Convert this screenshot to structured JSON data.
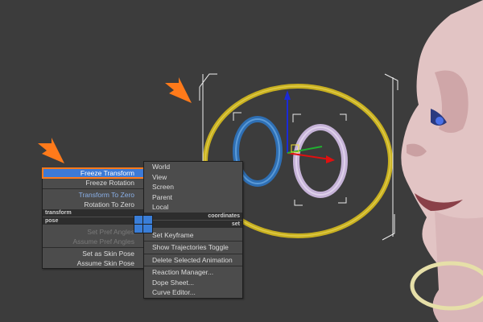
{
  "viewport": {
    "background": "#3c3c3c",
    "objects": [
      "gold-ring",
      "blue-ring",
      "lilac-ring",
      "cream-ring",
      "character-head",
      "transform-gizmo"
    ]
  },
  "quad_menu": {
    "transform_section": {
      "title": "transform",
      "items": [
        {
          "label": "Freeze Transform",
          "state": "highlighted"
        },
        {
          "label": "Freeze Rotation",
          "state": "normal"
        },
        {
          "label": "Transform To Zero",
          "state": "normal"
        },
        {
          "label": "Rotation To Zero",
          "state": "normal"
        }
      ]
    },
    "coordinates_section": {
      "title": "coordinates",
      "items": [
        "World",
        "View",
        "Screen",
        "Parent",
        "Local"
      ]
    },
    "pose_section": {
      "title": "pose",
      "items": [
        {
          "label": "Set Pref Angles",
          "state": "disabled"
        },
        {
          "label": "Assume Pref Angles",
          "state": "disabled"
        },
        {
          "label": "Set as Skin Pose",
          "state": "normal"
        },
        {
          "label": "Assume Skin Pose",
          "state": "normal"
        }
      ]
    },
    "set_section": {
      "title": "set",
      "items": [
        "Set Keyframe",
        "Show Trajectories Toggle",
        "Delete Selected Animation"
      ],
      "extra_items": [
        "Reaction Manager...",
        "Dope Sheet...",
        "Curve Editor..."
      ]
    }
  },
  "colors": {
    "highlight": "#3d7ad6",
    "callout_arrow": "#ff7a1a",
    "menu_bg": "#4c4c4c",
    "gold_ring": "#c8b020"
  },
  "icons": [
    "callout-arrow-icon",
    "quad-center-icon",
    "gizmo-icon"
  ]
}
